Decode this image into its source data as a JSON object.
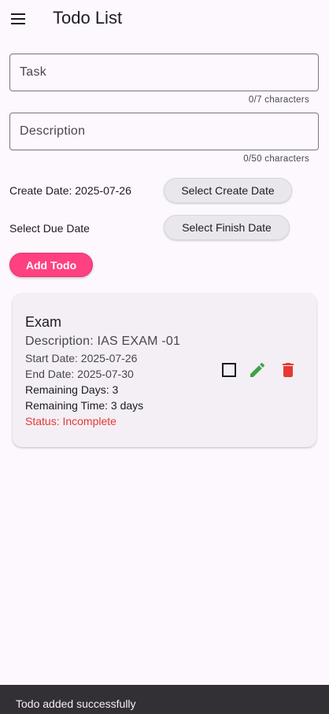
{
  "appbar": {
    "title": "Todo List",
    "menu_icon": "menu-icon"
  },
  "form": {
    "task": {
      "placeholder": "Task",
      "value": "",
      "counter": "0/7 characters"
    },
    "description": {
      "placeholder": "Description",
      "value": "",
      "counter": "0/50 characters"
    },
    "create_date_label": "Create Date: 2025-07-26",
    "create_date_button": "Select Create Date",
    "due_date_label": "Select Due Date",
    "finish_date_button": "Select Finish Date",
    "add_button": "Add Todo"
  },
  "todos": [
    {
      "title": "Exam",
      "description": "Description: IAS EXAM -01",
      "start_date": "Start Date: 2025-07-26",
      "end_date": "End Date: 2025-07-30",
      "remaining_days": "Remaining Days: 3",
      "remaining_time": "Remaining Time: 3 days",
      "status": "Status: Incomplete",
      "completed": false,
      "icons": [
        "checkbox-icon",
        "edit-icon",
        "delete-icon"
      ]
    }
  ],
  "snackbar": {
    "message": "Todo added successfully"
  },
  "colors": {
    "background": "#fdf7fe",
    "accent": "#ff4081",
    "edit": "#43a047",
    "delete": "#e53935",
    "status_incomplete": "#e53935",
    "snackbar": "#322f35"
  }
}
